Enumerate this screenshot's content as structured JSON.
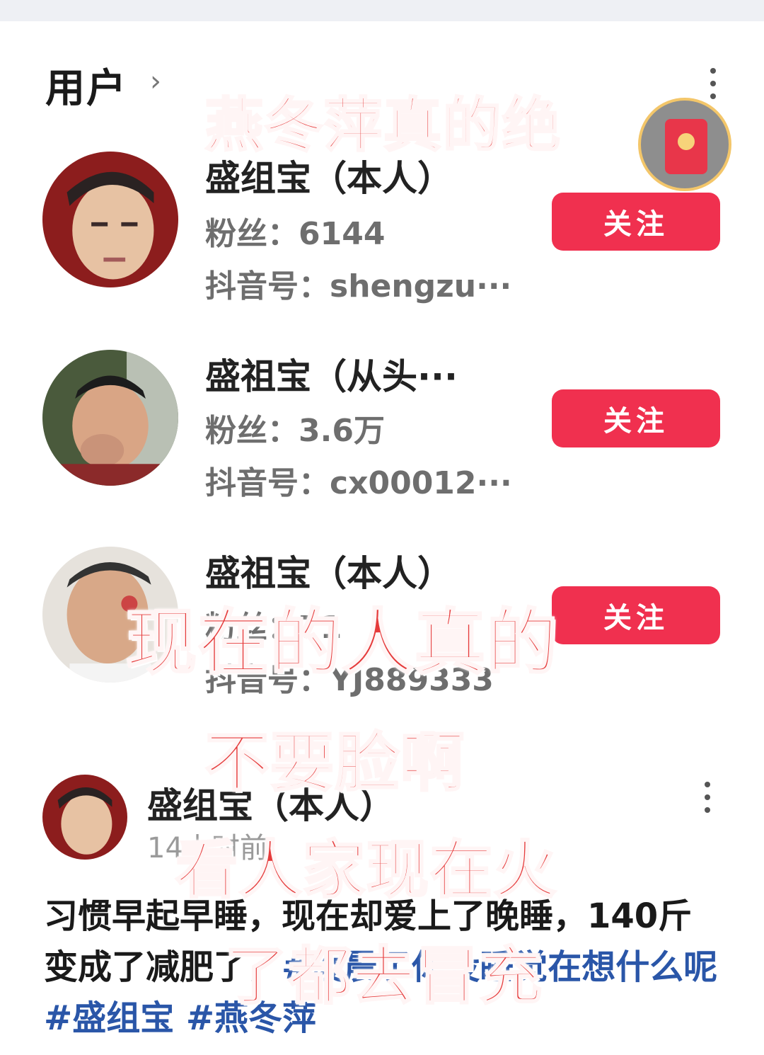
{
  "section": {
    "title": "用户"
  },
  "users": [
    {
      "name": "盛组宝（本人）",
      "fans": "粉丝：6144",
      "douyin_id": "抖音号：shengzu···",
      "follow_label": "关注"
    },
    {
      "name": "盛祖宝（从头···",
      "fans": "粉丝：3.6万",
      "douyin_id": "抖音号：cx00012···",
      "follow_label": "关注"
    },
    {
      "name": "盛祖宝（本人）",
      "fans": "粉丝：71",
      "douyin_id": "抖音号：YJ889333",
      "follow_label": "关注"
    }
  ],
  "post": {
    "author": "盛组宝（本人）",
    "time": "14小时前",
    "text_plain": "习惯早起早睡，现在却爱上了晚睡，140斤变成了",
    "text_tail": "减肥了，",
    "hashtags": "#凌晨了你没睡觉在想什么呢 #盛组宝 #燕冬萍"
  },
  "overlay_captions": [
    "燕冬萍真的绝",
    "现在的人真的",
    "不要脸啊",
    "看人家现在火",
    "了都去冒充"
  ],
  "icons": {
    "menu": "more-vertical-icon",
    "chevron": "chevron-right-icon",
    "red_packet": "red-packet-icon"
  },
  "colors": {
    "follow_button": "#f0304f",
    "overlay_text": "#e53a3a",
    "hashtag": "#2a56a8"
  }
}
